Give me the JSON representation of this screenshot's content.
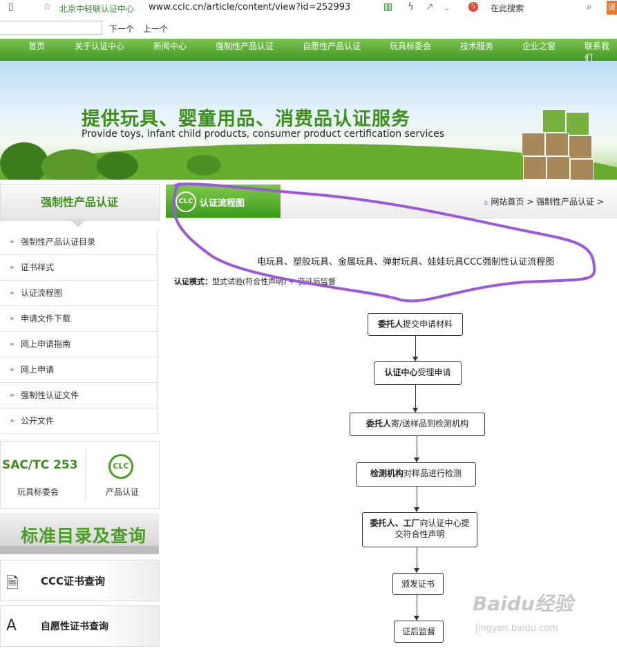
{
  "browser": {
    "site_name": "北京中轻联认证中心",
    "url": "www.cclc.cn/article/content/view?id=252993",
    "search_placeholder": "在此搜索",
    "find_next": "下一个",
    "find_prev": "上一个",
    "edge_label": "译"
  },
  "nav": {
    "items": [
      "首页",
      "关于认证中心",
      "新闻中心",
      "强制性产品认证",
      "自愿性产品认证",
      "玩具标委会",
      "技术服务",
      "企业之窗",
      "联系我们"
    ]
  },
  "banner": {
    "title_cn": "提供玩具、婴童用品、消费品认证服务",
    "title_en": "Provide toys, infant child products, consumer product certification services"
  },
  "sidebar": {
    "header": "强制性产品认证",
    "items": [
      {
        "label": "强制性产品认证目录"
      },
      {
        "label": "证书样式"
      },
      {
        "label": "认证流程图"
      },
      {
        "label": "申请文件下载"
      },
      {
        "label": "网上申请指南"
      },
      {
        "label": "网上申请"
      },
      {
        "label": "强制性认证文件"
      },
      {
        "label": "公开文件"
      }
    ],
    "promo": {
      "sac_title": "SAC/TC 253",
      "sac_label": "玩具标委会",
      "clc_logo": "CLC",
      "clc_label": "产品认证",
      "standards": "标准目录及查询",
      "ccc_query": "CCC证书查询",
      "voluntary_query": "自愿性证书查询"
    }
  },
  "main": {
    "tab_logo": "CLC",
    "tab_title": "认证流程图",
    "breadcrumb": [
      "网站首页",
      "强制性产品认证"
    ],
    "page_title": "电玩具、塑胶玩具、金属玩具、弹射玩具、娃娃玩具CCC强制性认证流程图",
    "mode_label": "认证模式：",
    "mode_value": "型式试验(符合性声明) + 获证后监督"
  },
  "flow": {
    "steps": [
      {
        "bold": "委托人",
        "text": "提交申请材料"
      },
      {
        "bold": "认证中心",
        "text": "受理申请"
      },
      {
        "bold": "委托人",
        "text": "寄/送样品到检测机构"
      },
      {
        "bold": "检测机构",
        "text": "对样品进行检测"
      },
      {
        "bold": "委托人、工厂",
        "text": "向认证中心提交符合性声明"
      },
      {
        "bold": "",
        "text": "颁发证书"
      },
      {
        "bold": "",
        "text": "证后监督"
      }
    ]
  },
  "watermark": {
    "main": "Baidu经验",
    "sub": "jingyan.baidu.com"
  },
  "colors": {
    "green": "#3c8f1a",
    "annotation": "#9b59d9"
  }
}
